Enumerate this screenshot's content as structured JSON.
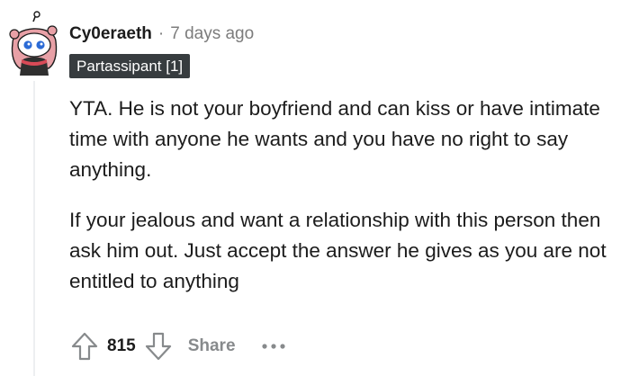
{
  "comment": {
    "author": "Cy0eraeth",
    "separator": "·",
    "timestamp": "7 days ago",
    "flair": "Partassipant [1]",
    "paragraphs": [
      "YTA. He is not your boyfriend and can kiss or have intimate time with anyone he wants and you have no right to say anything.",
      "If your jealous and want a relationship with this person then ask him out. Just accept the answer he gives as you are not entitled to anything"
    ],
    "score": "815",
    "share_label": "Share",
    "more_label": "•••"
  },
  "icons": {
    "avatar": "snoo-avatar-icon",
    "upvote": "upvote-arrow-icon",
    "downvote": "downvote-arrow-icon",
    "more": "more-options-icon"
  },
  "colors": {
    "text": "#1c1c1c",
    "meta": "#7c7c7c",
    "flair_bg": "#373c3f",
    "action_gray": "#878a8c",
    "thread_line": "#edeff1"
  }
}
